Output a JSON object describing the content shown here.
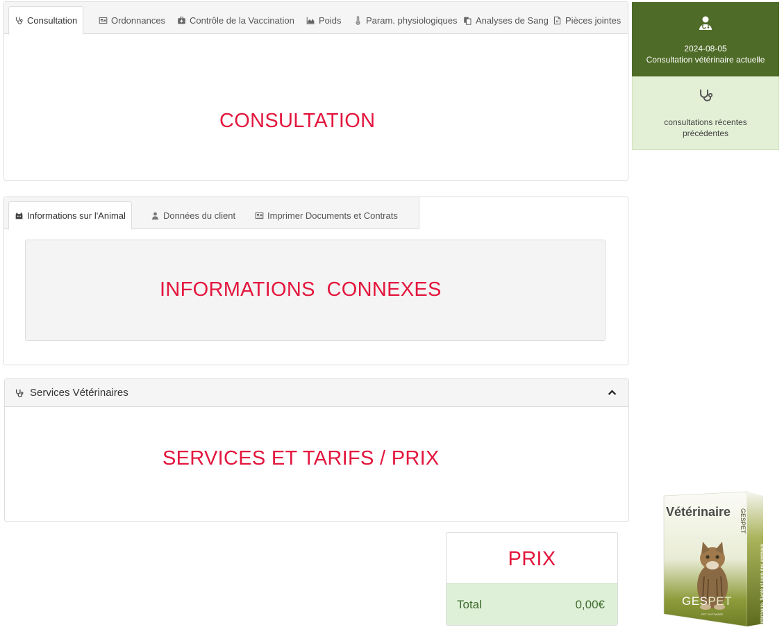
{
  "consultation_panel": {
    "tabs": [
      {
        "label": "Consultation",
        "icon": "stethoscope-icon"
      },
      {
        "label": "Ordonnances",
        "icon": "prescription-icon"
      },
      {
        "label": "Contrôle de la Vaccination",
        "icon": "medical-kit-icon"
      },
      {
        "label": "Poids",
        "icon": "area-chart-icon"
      },
      {
        "label": "Param. physiologiques",
        "icon": "thermometer-icon"
      },
      {
        "label": "Analyses de Sang",
        "icon": "copy-icon"
      },
      {
        "label": "Pièces jointes",
        "icon": "file-icon"
      }
    ],
    "placeholder": "CONSULTATION"
  },
  "side": {
    "current": {
      "date": "2024-08-05",
      "label": "Consultation vétérinaire actuelle",
      "icon": "user-doctor-icon"
    },
    "recent": {
      "line1": "consultations récentes",
      "line2": "précédentes",
      "icon": "stethoscope-icon"
    }
  },
  "info_panel": {
    "tabs": [
      {
        "label": "Informations sur l'Animal",
        "icon": "cat-icon"
      },
      {
        "label": "Données du client",
        "icon": "user-icon"
      },
      {
        "label": "Imprimer Documents et Contrats",
        "icon": "document-icon"
      }
    ],
    "placeholder_word1": "INFORMATIONS",
    "placeholder_word2": "CONNEXES"
  },
  "services_panel": {
    "title": "Services Vétérinaires",
    "placeholder": "SERVICES ET TARIFS / PRIX",
    "collapse_icon": "chevron-up-icon"
  },
  "price_box": {
    "placeholder": "PRIX",
    "total_label": "Total",
    "total_value": "0,00€"
  },
  "product_box": {
    "title": "Vétérinaire",
    "brand_left": "GES",
    "brand_right": "PET",
    "spine": "Vétérinaire. Santé et soin des animaux",
    "spine_brand": "GESPET",
    "subtitle": "PET SOFTWARE"
  },
  "colors": {
    "accent_red": "#e3163d",
    "green_dark": "#4e6b27",
    "green_light": "#e3f0d6",
    "total_green": "#3c6b2d"
  }
}
